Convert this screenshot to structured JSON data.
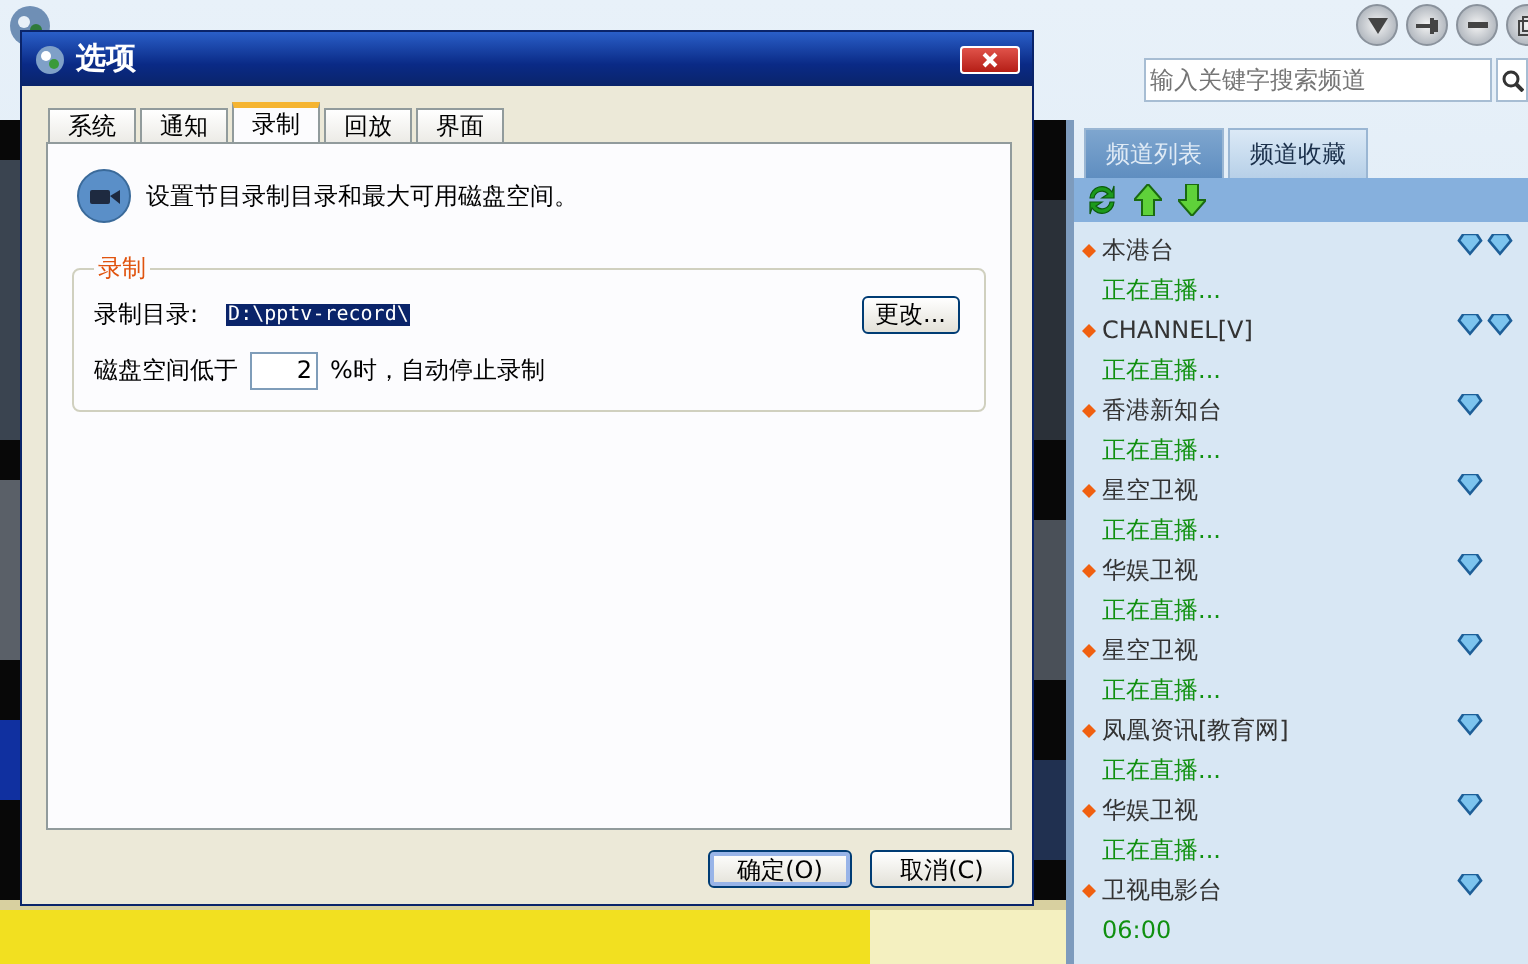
{
  "search": {
    "placeholder": "输入关键字搜索频道"
  },
  "channel_tabs": [
    {
      "label": "频道列表",
      "selected": true
    },
    {
      "label": "频道收藏",
      "selected": false
    }
  ],
  "channels": [
    {
      "kind": "double",
      "name": "本港台",
      "status": "正在直播..."
    },
    {
      "kind": "double",
      "name": "CHANNEL[V]",
      "status": "正在直播..."
    },
    {
      "kind": "single",
      "name": "香港新知台",
      "status": "正在直播..."
    },
    {
      "kind": "single",
      "name": "星空卫视",
      "status": "正在直播..."
    },
    {
      "kind": "single",
      "name": "华娱卫视",
      "status": "正在直播..."
    },
    {
      "kind": "single",
      "name": "星空卫视",
      "status": "正在直播..."
    },
    {
      "kind": "single",
      "name": "凤凰资讯[教育网]",
      "status": "正在直播..."
    },
    {
      "kind": "single",
      "name": "华娱卫视",
      "status": "正在直播..."
    },
    {
      "kind": "single",
      "name": "卫视电影台",
      "status": "06:00"
    }
  ],
  "dialog": {
    "title": "选项",
    "tabs": [
      {
        "label": "系统",
        "selected": false
      },
      {
        "label": "通知",
        "selected": false
      },
      {
        "label": "录制",
        "selected": true
      },
      {
        "label": "回放",
        "selected": false
      },
      {
        "label": "界面",
        "selected": false
      }
    ],
    "description": "设置节目录制目录和最大可用磁盘空间。",
    "group": {
      "title": "录制",
      "directory_label": "录制目录:",
      "directory_value": "D:\\pptv-record\\",
      "change_button": "更改...",
      "disk_label": "磁盘空间低于",
      "disk_value": "2",
      "disk_suffix": "%时，自动停止录制"
    },
    "buttons": [
      {
        "label": "确定(O)",
        "default": true
      },
      {
        "label": "取消(C)",
        "default": false
      }
    ]
  }
}
